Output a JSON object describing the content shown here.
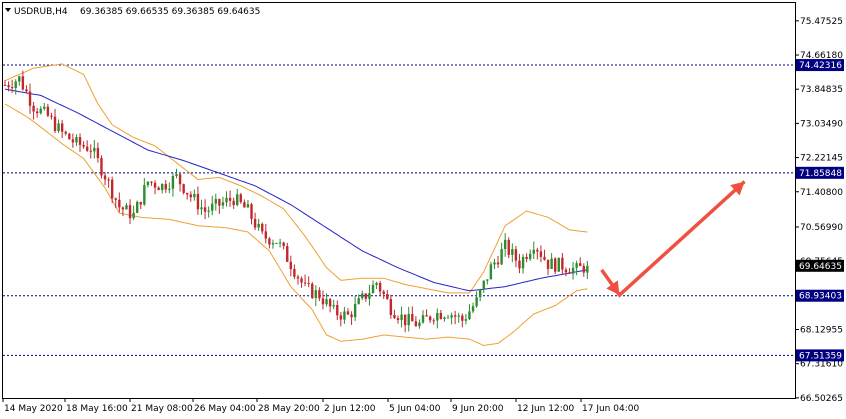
{
  "header": {
    "symbol_tf": "USDRUB,H4",
    "ohlc": "69.36385 69.66535 69.36385 69.64635"
  },
  "colors": {
    "background": "#ffffff",
    "bull": "#2e8b2e",
    "bear": "#c0282d",
    "band": "#f0a030",
    "ma": "#2424c8",
    "level_line": "#000080",
    "arrow": "#f05040",
    "label_box": "#000080",
    "current_price_box": "#000000"
  },
  "chart_data": {
    "type": "candlestick",
    "title": "",
    "xlabel": "",
    "ylabel": "",
    "ylim": [
      66.5,
      75.9
    ],
    "grid": false,
    "y_ticks": [
      "75.47525",
      "74.66180",
      "73.84835",
      "73.03490",
      "72.22145",
      "71.40800",
      "70.56990",
      "69.75645",
      "68.12955",
      "67.31610",
      "66.50265"
    ],
    "x_ticks": [
      "14 May 2020",
      "18 May 16:00",
      "21 May 08:00",
      "26 May 04:00",
      "28 May 20:00",
      "2 Jun 12:00",
      "5 Jun 04:00",
      "9 Jun 20:00",
      "12 Jun 12:00",
      "17 Jun 04:00"
    ],
    "horizontal_levels": [
      {
        "label": "74.42316",
        "value": 74.42316
      },
      {
        "label": "71.85848",
        "value": 71.85848
      },
      {
        "label": "68.93403",
        "value": 68.93403
      },
      {
        "label": "67.51359",
        "value": 67.51359
      }
    ],
    "current_price": {
      "label": "69.64635",
      "value": 69.64635
    },
    "close_path": [
      [
        0,
        73.95
      ],
      [
        4,
        74.1
      ],
      [
        8,
        73.45
      ],
      [
        12,
        73.2
      ],
      [
        16,
        72.8
      ],
      [
        20,
        72.55
      ],
      [
        24,
        72.45
      ],
      [
        28,
        71.8
      ],
      [
        32,
        71.05
      ],
      [
        36,
        70.85
      ],
      [
        40,
        71.65
      ],
      [
        44,
        71.55
      ],
      [
        48,
        71.75
      ],
      [
        52,
        71.3
      ],
      [
        56,
        70.95
      ],
      [
        60,
        71.1
      ],
      [
        64,
        71.25
      ],
      [
        68,
        70.95
      ],
      [
        72,
        70.35
      ],
      [
        76,
        70.25
      ],
      [
        80,
        69.7
      ],
      [
        84,
        69.1
      ],
      [
        88,
        68.95
      ],
      [
        92,
        68.55
      ],
      [
        96,
        68.45
      ],
      [
        100,
        68.85
      ],
      [
        104,
        69.25
      ],
      [
        108,
        68.65
      ],
      [
        112,
        68.35
      ],
      [
        116,
        68.25
      ],
      [
        120,
        68.5
      ],
      [
        124,
        68.55
      ],
      [
        128,
        68.35
      ],
      [
        132,
        68.8
      ],
      [
        136,
        69.6
      ],
      [
        140,
        70.1
      ],
      [
        144,
        69.7
      ],
      [
        148,
        70.2
      ],
      [
        152,
        69.7
      ],
      [
        156,
        69.65
      ],
      [
        160,
        69.55
      ],
      [
        163,
        69.64635
      ]
    ],
    "upper_band_path": [
      [
        0,
        74.05
      ],
      [
        8,
        74.35
      ],
      [
        16,
        74.45
      ],
      [
        22,
        74.2
      ],
      [
        26,
        73.5
      ],
      [
        30,
        73.0
      ],
      [
        36,
        72.7
      ],
      [
        42,
        72.5
      ],
      [
        48,
        72.1
      ],
      [
        54,
        71.7
      ],
      [
        60,
        71.75
      ],
      [
        66,
        71.55
      ],
      [
        72,
        71.3
      ],
      [
        78,
        71.0
      ],
      [
        84,
        70.35
      ],
      [
        90,
        69.6
      ],
      [
        94,
        69.3
      ],
      [
        100,
        69.35
      ],
      [
        106,
        69.35
      ],
      [
        112,
        69.2
      ],
      [
        118,
        69.1
      ],
      [
        124,
        69.0
      ],
      [
        130,
        69.0
      ],
      [
        134,
        69.5
      ],
      [
        140,
        70.6
      ],
      [
        146,
        70.95
      ],
      [
        152,
        70.8
      ],
      [
        158,
        70.5
      ],
      [
        163,
        70.45
      ]
    ],
    "lower_band_path": [
      [
        0,
        73.5
      ],
      [
        6,
        73.2
      ],
      [
        10,
        72.95
      ],
      [
        16,
        72.55
      ],
      [
        22,
        72.2
      ],
      [
        28,
        71.5
      ],
      [
        32,
        70.9
      ],
      [
        38,
        70.8
      ],
      [
        46,
        70.75
      ],
      [
        54,
        70.6
      ],
      [
        62,
        70.55
      ],
      [
        68,
        70.45
      ],
      [
        74,
        70.0
      ],
      [
        80,
        69.15
      ],
      [
        86,
        68.6
      ],
      [
        90,
        68.0
      ],
      [
        94,
        67.85
      ],
      [
        100,
        67.9
      ],
      [
        106,
        68.0
      ],
      [
        112,
        67.95
      ],
      [
        118,
        67.9
      ],
      [
        124,
        67.95
      ],
      [
        130,
        67.9
      ],
      [
        134,
        67.75
      ],
      [
        138,
        67.8
      ],
      [
        142,
        68.05
      ],
      [
        148,
        68.5
      ],
      [
        154,
        68.7
      ],
      [
        160,
        69.05
      ],
      [
        163,
        69.1
      ]
    ],
    "ma_path": [
      [
        0,
        73.85
      ],
      [
        10,
        73.7
      ],
      [
        20,
        73.3
      ],
      [
        30,
        72.85
      ],
      [
        40,
        72.4
      ],
      [
        50,
        72.15
      ],
      [
        60,
        71.85
      ],
      [
        70,
        71.55
      ],
      [
        80,
        71.1
      ],
      [
        90,
        70.55
      ],
      [
        100,
        70.0
      ],
      [
        110,
        69.6
      ],
      [
        120,
        69.25
      ],
      [
        130,
        69.05
      ],
      [
        140,
        69.15
      ],
      [
        150,
        69.35
      ],
      [
        163,
        69.55
      ]
    ],
    "projection_arrow": [
      {
        "t": 167,
        "price": 69.55
      },
      {
        "t": 172,
        "price": 68.95
      },
      {
        "t": 207,
        "price": 71.65
      }
    ]
  }
}
